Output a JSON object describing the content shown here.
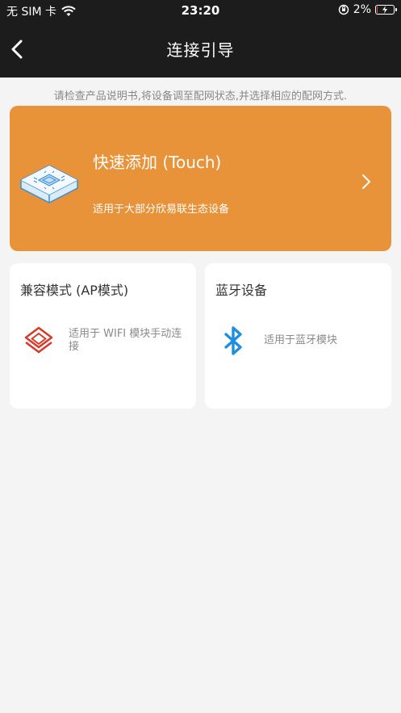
{
  "status_bar": {
    "carrier": "无 SIM 卡",
    "time": "23:20",
    "battery_percent": "2%",
    "battery_level": 0.02,
    "icons": [
      "wifi-icon",
      "orientation-lock-icon",
      "battery-charging-icon"
    ]
  },
  "nav": {
    "title": "连接引导",
    "back_icon": "chevron-left-icon"
  },
  "hint": "请检查产品说明书,将设备调至配网状态,并选择相应的配网方式.",
  "touch_card": {
    "title": "快速添加 (Touch)",
    "description": "适用于大部分欣易联生态设备",
    "icon": "chip-device-icon",
    "color": "#e8933a"
  },
  "ap_card": {
    "title": "兼容模式 (AP模式)",
    "description": "适用于 WIFI 模块手动连接",
    "icon": "layers-icon",
    "icon_color": "#d9392b"
  },
  "ble_card": {
    "title": "蓝牙设备",
    "description": "适用于蓝牙模块",
    "icon": "bluetooth-icon",
    "icon_color": "#1e8fdc"
  }
}
